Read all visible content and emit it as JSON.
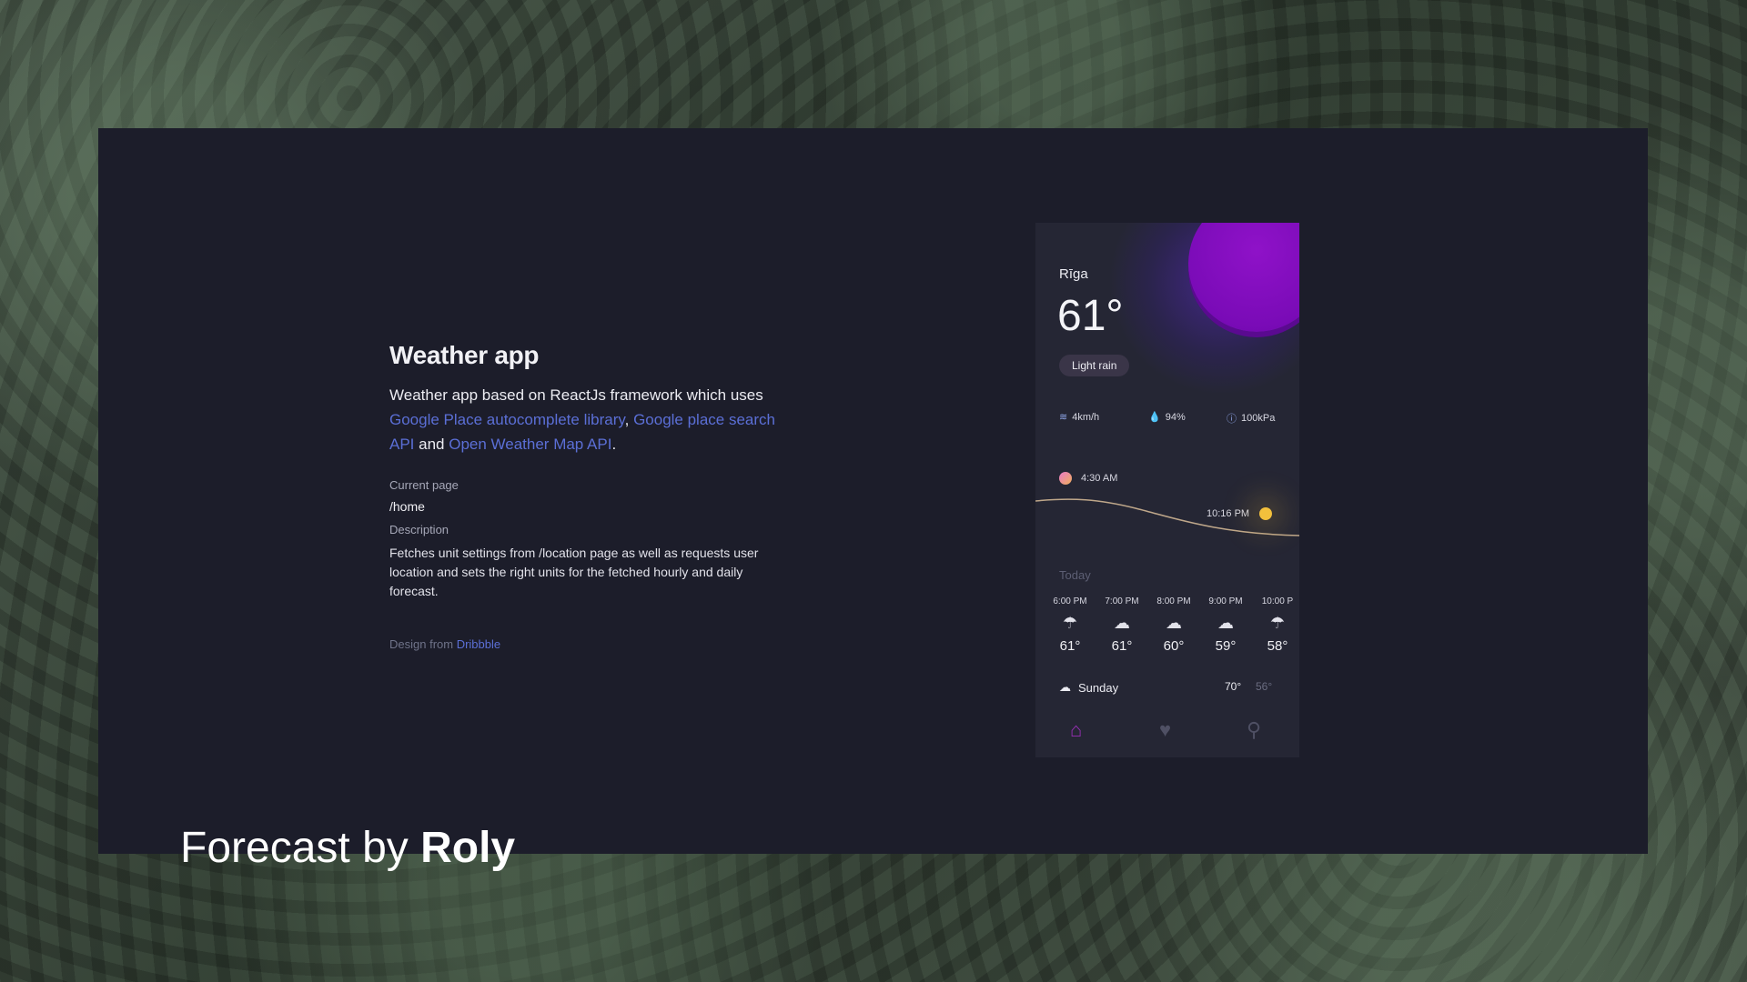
{
  "project": {
    "title": "Weather app",
    "intro_text": "Weather app based on ReactJs framework which uses ",
    "link1": "Google Place autocomplete library",
    "sep1": ", ",
    "link2": "Google place search API",
    "sep2": " and ",
    "link3": "Open Weather Map API",
    "end": ".",
    "current_page_label": "Current page",
    "current_page_value": "/home",
    "description_label": "Description",
    "description_value": "Fetches unit settings from /location page as well as requests user location and sets the right units for the fetched hourly and daily forecast.",
    "credit_prefix": "Design from ",
    "credit_link": "Dribbble"
  },
  "footer": {
    "prefix": "Forecast by ",
    "author": "Roly"
  },
  "phone": {
    "city": "Rīga",
    "temperature": "61°",
    "condition": "Light rain",
    "wind": "4km/h",
    "humidity": "94%",
    "pressure": "100kPa",
    "sunrise": "4:30 AM",
    "sunset": "10:16 PM",
    "today_label": "Today",
    "hourly": [
      {
        "time": "6:00 PM",
        "temp": "61°",
        "icon": "rain-cloud-icon"
      },
      {
        "time": "7:00 PM",
        "temp": "61°",
        "icon": "cloud-upload-icon"
      },
      {
        "time": "8:00 PM",
        "temp": "60°",
        "icon": "cloud-upload-icon"
      },
      {
        "time": "9:00 PM",
        "temp": "59°",
        "icon": "cloud-upload-icon"
      },
      {
        "time": "10:00 P",
        "temp": "58°",
        "icon": "rain-cloud-icon"
      }
    ],
    "daily": {
      "day": "Sunday",
      "high": "70°",
      "low": "56°"
    },
    "colors": {
      "accent": "#9a2fb8",
      "sun": "#7a0bb7",
      "link": "#5b6fd6"
    }
  }
}
